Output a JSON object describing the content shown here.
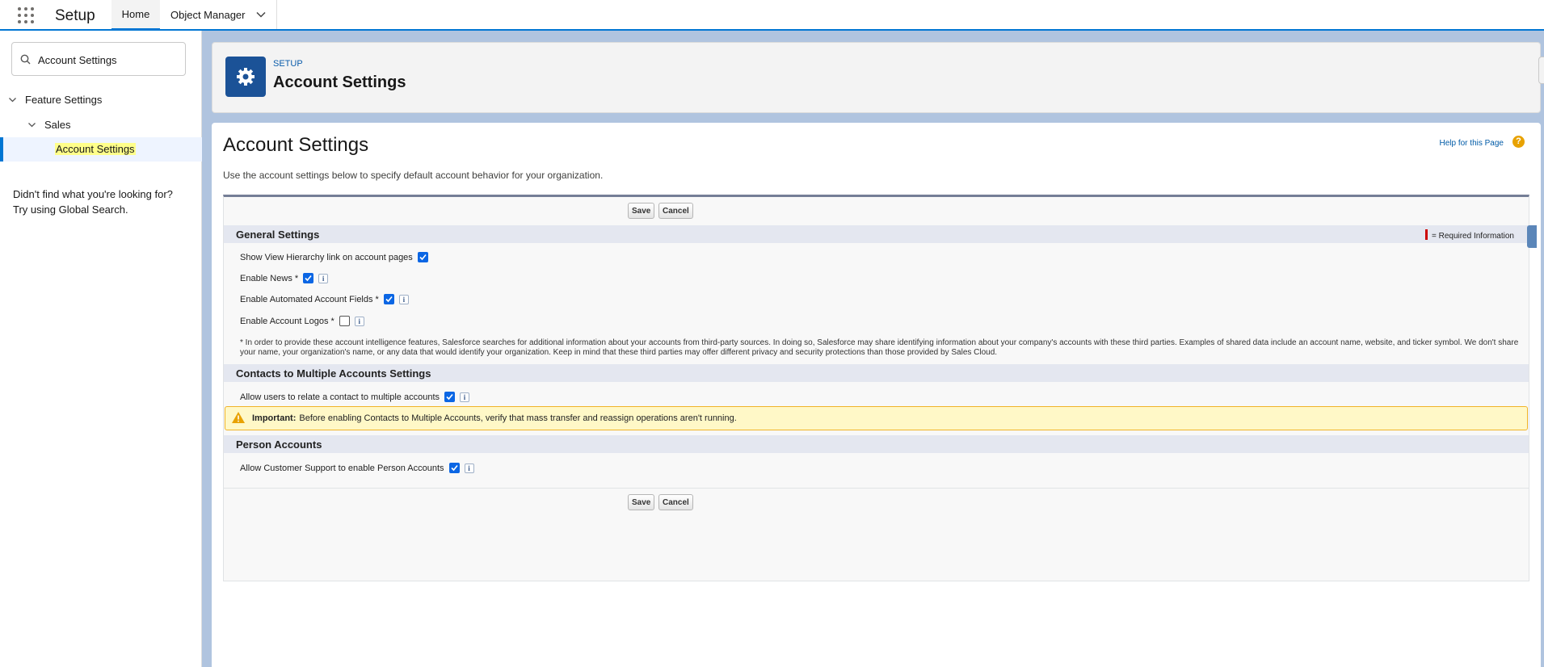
{
  "topnav": {
    "app_name": "Setup",
    "tabs": [
      {
        "label": "Home"
      },
      {
        "label": "Object Manager"
      }
    ]
  },
  "sidebar": {
    "search_value": "Account Settings",
    "tree": [
      {
        "label": "Feature Settings"
      },
      {
        "label": "Sales"
      },
      {
        "label": "Account Settings"
      }
    ],
    "not_found_line1": "Didn't find what you're looking for?",
    "not_found_line2": "Try using Global Search."
  },
  "header": {
    "eyebrow": "SETUP",
    "title": "Account Settings"
  },
  "page": {
    "title": "Account Settings",
    "help_link": "Help for this Page",
    "help_icon": "?",
    "description": "Use the account settings below to specify default account behavior for your organization.",
    "save_label": "Save",
    "cancel_label": "Cancel",
    "required_label": "= Required Information"
  },
  "sections": {
    "general": {
      "title": "General Settings",
      "rows": [
        {
          "label": "Show View Hierarchy link on account pages",
          "checked": true
        },
        {
          "label": "Enable News *",
          "checked": true
        },
        {
          "label": "Enable Automated Account Fields *",
          "checked": true
        },
        {
          "label": "Enable Account Logos *",
          "checked": false
        }
      ],
      "note": "* In order to provide these account intelligence features, Salesforce searches for additional information about your accounts from third-party sources. In doing so, Salesforce may share identifying information about your company's accounts with these third parties. Examples of shared data include an account name, website, and ticker symbol. We don't share your name, your organization's name, or any data that would identify your organization. Keep in mind that these third parties may offer different privacy and security protections than those provided by Sales Cloud."
    },
    "contacts": {
      "title": "Contacts to Multiple Accounts Settings",
      "rows": [
        {
          "label": "Allow users to relate a contact to multiple accounts",
          "checked": true
        }
      ],
      "warning_bold": "Important:",
      "warning_text": "Before enabling Contacts to Multiple Accounts, verify that mass transfer and reassign operations aren't running."
    },
    "person": {
      "title": "Person Accounts",
      "rows": [
        {
          "label": "Allow Customer Support to enable Person Accounts",
          "checked": true
        }
      ]
    }
  },
  "icons": [
    "app-launcher-icon",
    "chevron-down-icon",
    "search-icon",
    "gear-icon",
    "checkbox-icon",
    "info-icon",
    "warning-icon",
    "help-icon"
  ],
  "colors": {
    "brand": "#0176d3",
    "section_header": "#e4e7f0",
    "warning_bg": "#fff8c7",
    "checkbox": "#0b66e4"
  }
}
